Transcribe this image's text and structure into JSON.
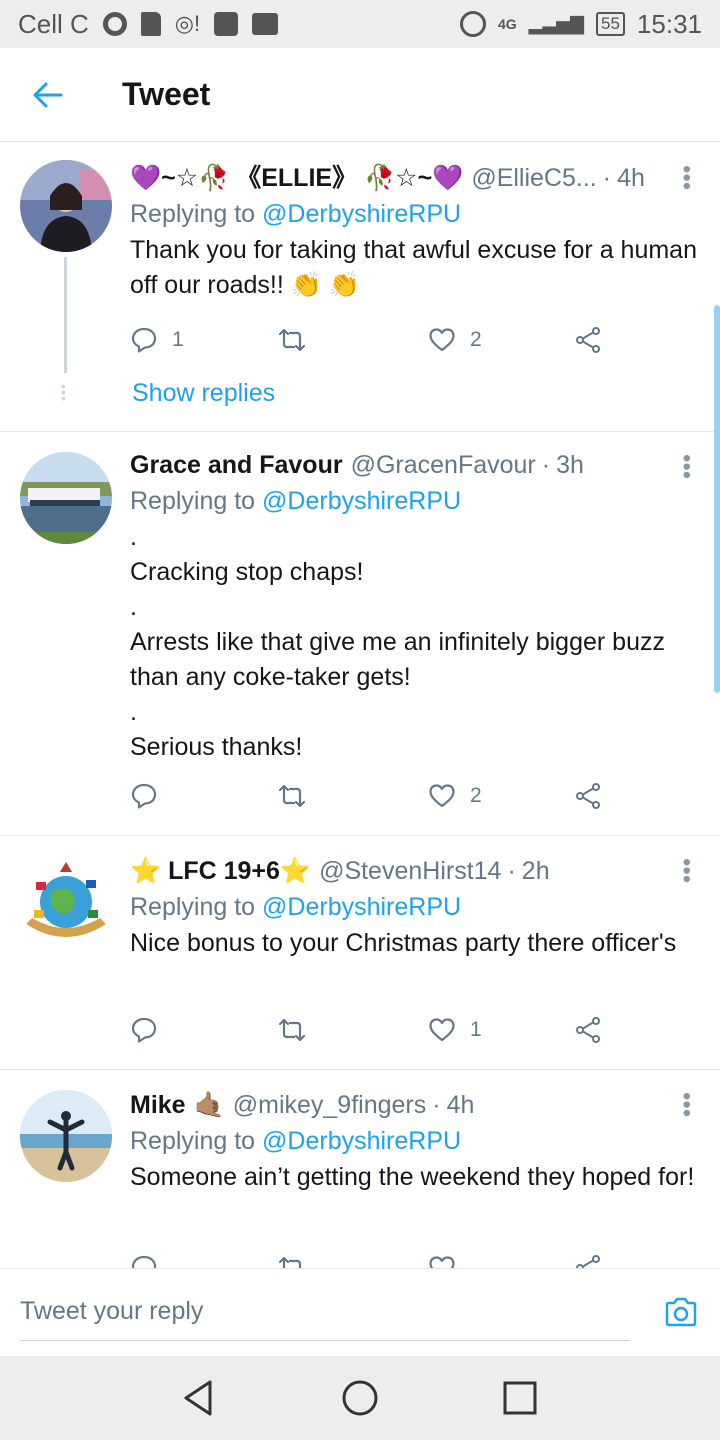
{
  "status": {
    "carrier": "Cell C",
    "network": "4G",
    "battery": "55",
    "time": "15:31"
  },
  "header": {
    "title": "Tweet",
    "back_icon": "arrow-left-icon"
  },
  "tweets": [
    {
      "name_prefix": "💜~☆🥀",
      "name": "《ELLIE》",
      "name_suffix": "🥀☆~💜",
      "handle": "@EllieC5...",
      "time": "4h",
      "replying_label": "Replying to",
      "replying_to": "@DerbyshireRPU",
      "text": "Thank you for taking that awful excuse for a human off our roads!! 👏 👏",
      "replies": "1",
      "retweets": "",
      "likes": "2",
      "show_replies": "Show replies"
    },
    {
      "name": "Grace and Favour",
      "handle": "@GracenFavour",
      "time": "3h",
      "replying_label": "Replying to",
      "replying_to": "@DerbyshireRPU",
      "text": ".\nCracking stop chaps!\n.\nArrests like that give me an infinitely bigger buzz than any coke-taker gets!\n.\nSerious thanks!",
      "replies": "",
      "retweets": "",
      "likes": "2"
    },
    {
      "name": "⭐ LFC 19+6⭐",
      "handle": "@StevenHirst14",
      "time": "2h",
      "replying_label": "Replying to",
      "replying_to": "@DerbyshireRPU",
      "text": "Nice bonus to your Christmas party there officer's",
      "replies": "",
      "retweets": "",
      "likes": "1"
    },
    {
      "name": "Mike",
      "name_emoji": "🤙🏽",
      "handle": "@mikey_9fingers",
      "time": "4h",
      "replying_label": "Replying to",
      "replying_to": "@DerbyshireRPU",
      "text": "Someone ain’t getting the weekend they hoped for!"
    }
  ],
  "reply": {
    "placeholder": "Tweet your reply",
    "camera_icon": "camera-icon"
  },
  "nav": {
    "back_icon": "nav-back-icon",
    "home_icon": "nav-home-icon",
    "recents_icon": "nav-recents-icon"
  },
  "colors": {
    "accent": "#1DA1F2",
    "muted": "#657786",
    "divider": "#E1E8ED"
  }
}
